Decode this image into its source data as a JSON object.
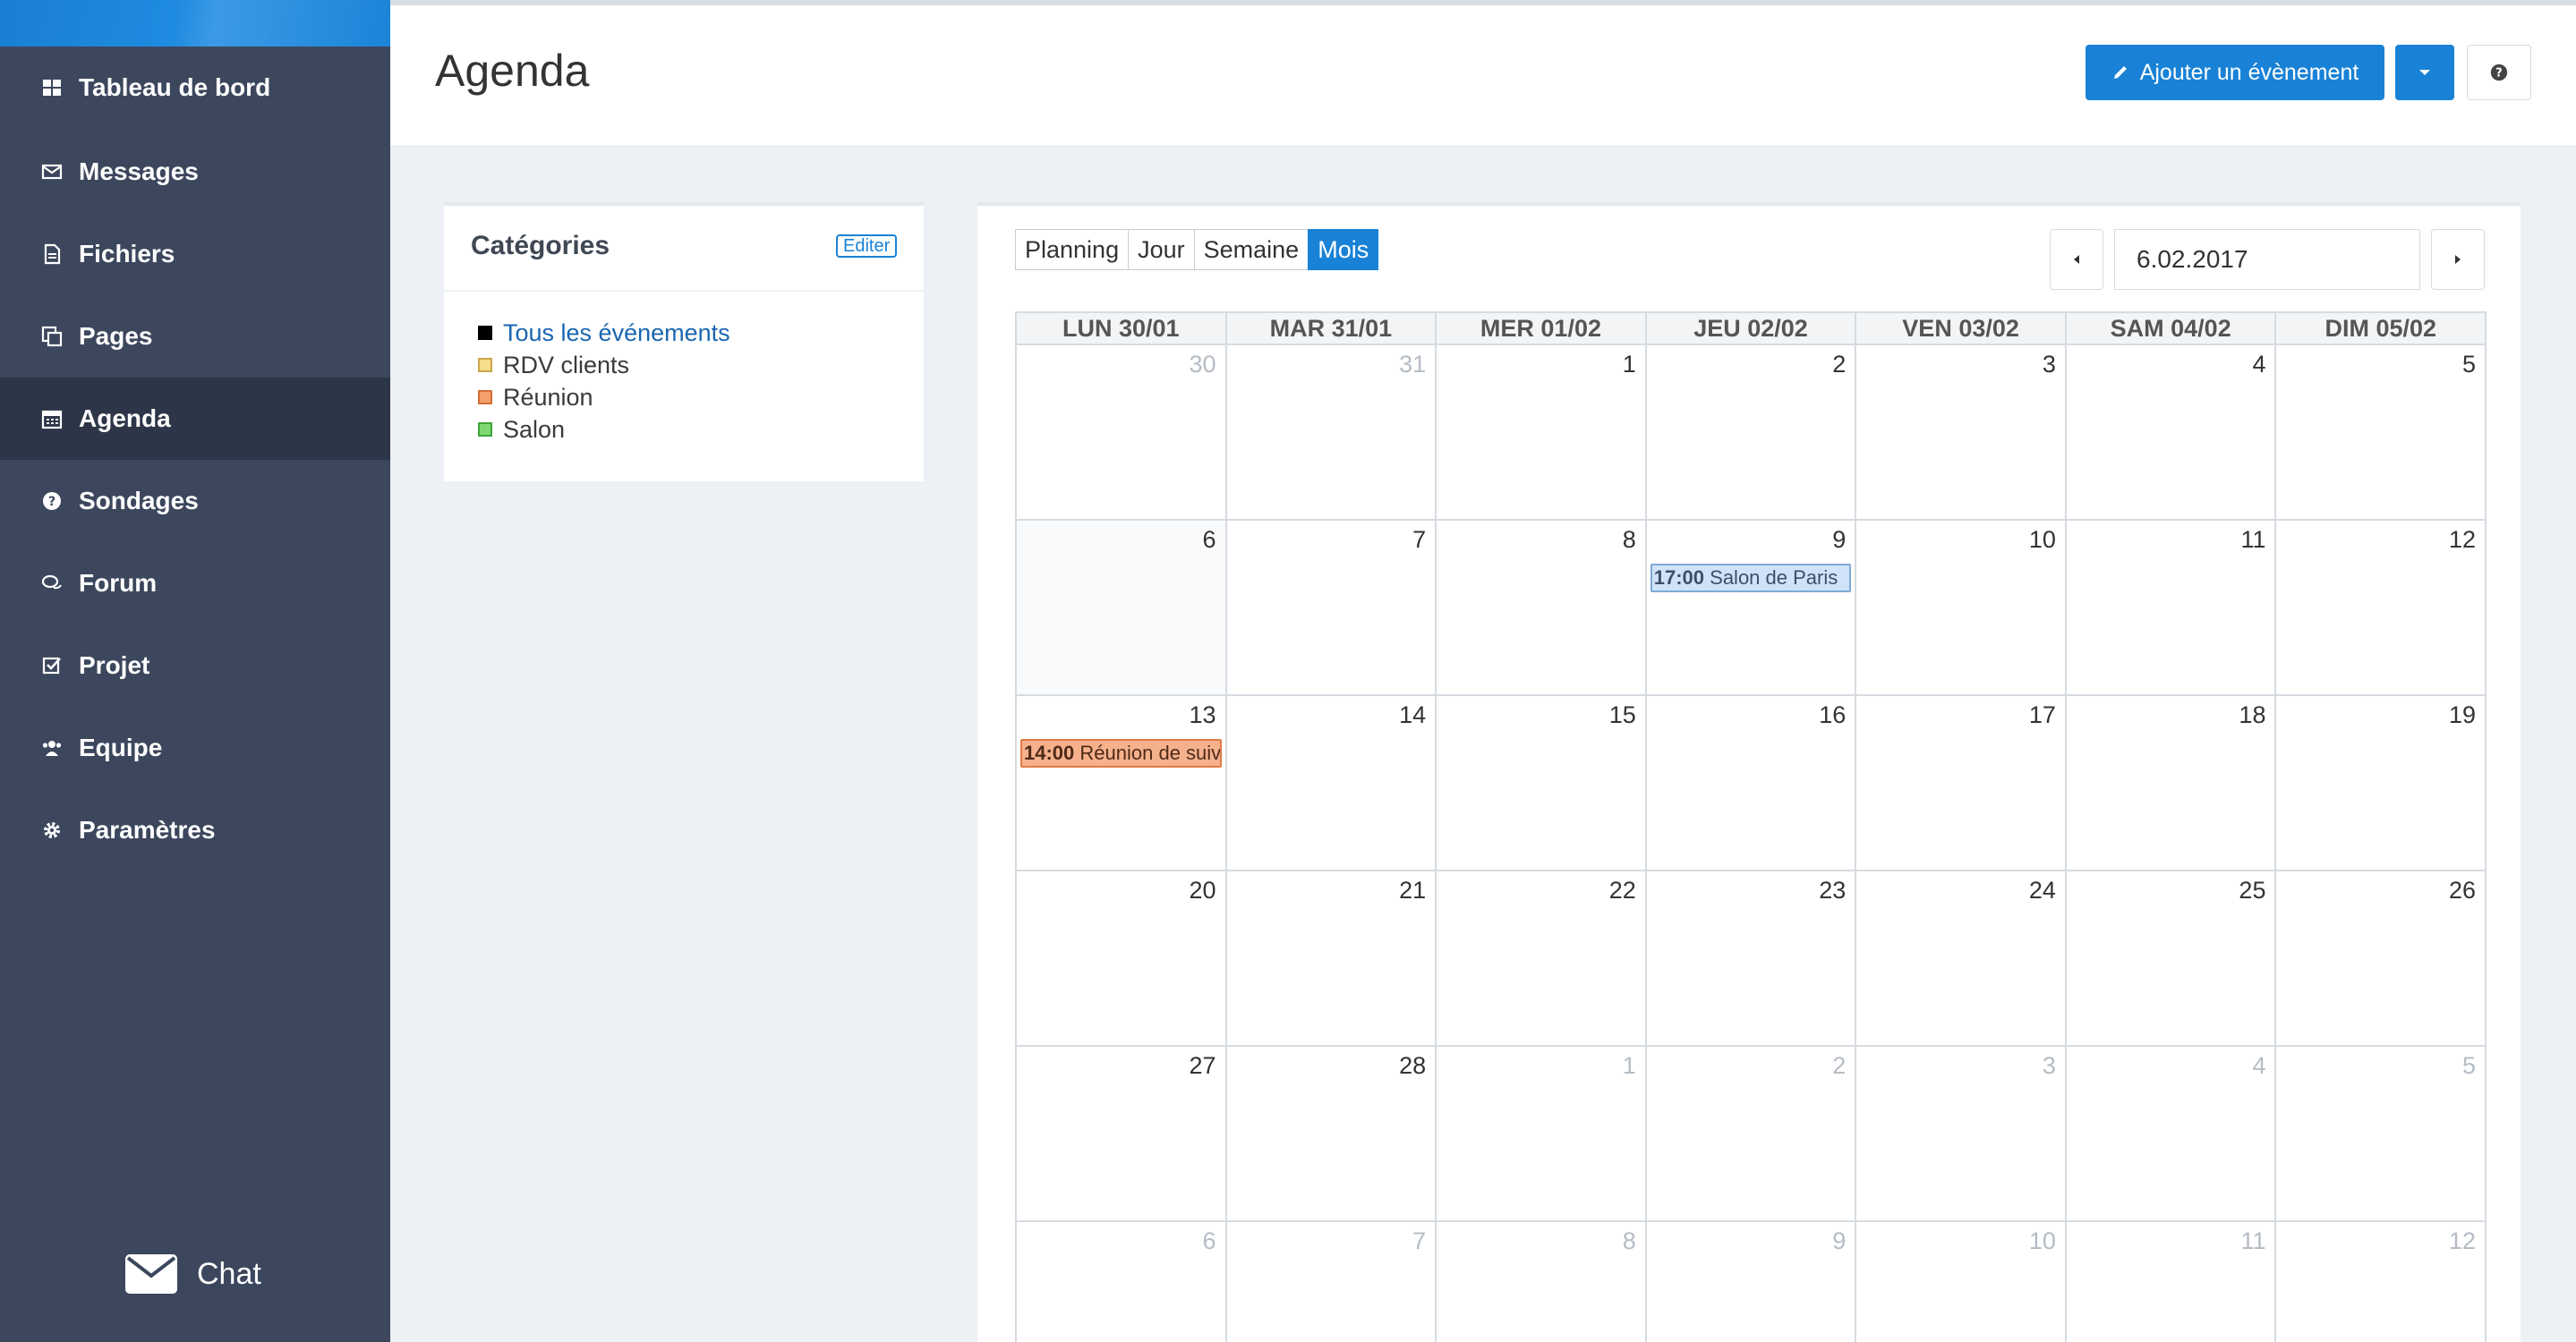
{
  "sidebar": {
    "items": [
      {
        "label": "Tableau de bord",
        "icon": "dashboard-icon"
      },
      {
        "label": "Messages",
        "icon": "envelope-icon"
      },
      {
        "label": "Fichiers",
        "icon": "file-icon"
      },
      {
        "label": "Pages",
        "icon": "pages-icon"
      },
      {
        "label": "Agenda",
        "icon": "calendar-icon",
        "active": true
      },
      {
        "label": "Sondages",
        "icon": "question-icon"
      },
      {
        "label": "Forum",
        "icon": "comments-icon"
      },
      {
        "label": "Projet",
        "icon": "checkbox-icon"
      },
      {
        "label": "Equipe",
        "icon": "users-icon"
      },
      {
        "label": "Paramètres",
        "icon": "gear-icon"
      }
    ],
    "chat_label": "Chat"
  },
  "header": {
    "title": "Agenda",
    "add_label": "Ajouter un évènement"
  },
  "categories": {
    "title": "Catégories",
    "edit_label": "Editer",
    "items": [
      {
        "label": "Tous les événements",
        "color": "#000000"
      },
      {
        "label": "RDV clients",
        "color": "#f7dc8c"
      },
      {
        "label": "Réunion",
        "color": "#f5a06c"
      },
      {
        "label": "Salon",
        "color": "#7fd86f"
      }
    ]
  },
  "calendar": {
    "views": [
      "Planning",
      "Jour",
      "Semaine",
      "Mois"
    ],
    "active_view": "Mois",
    "date": "6.02.2017",
    "weekdays": [
      "LUN 30/01",
      "MAR 31/01",
      "MER 01/02",
      "JEU 02/02",
      "VEN 03/02",
      "SAM 04/02",
      "DIM 05/02"
    ],
    "weeks": [
      [
        "30",
        "31",
        "1",
        "2",
        "3",
        "4",
        "5"
      ],
      [
        "6",
        "7",
        "8",
        "9",
        "10",
        "11",
        "12"
      ],
      [
        "13",
        "14",
        "15",
        "16",
        "17",
        "18",
        "19"
      ],
      [
        "20",
        "21",
        "22",
        "23",
        "24",
        "25",
        "26"
      ],
      [
        "27",
        "28",
        "1",
        "2",
        "3",
        "4",
        "5"
      ],
      [
        "6",
        "7",
        "8",
        "9",
        "10",
        "11",
        "12"
      ]
    ],
    "events": [
      {
        "time": "17:00",
        "title": "Salon de Paris",
        "category": "salon"
      },
      {
        "time": "14:00",
        "title": "Réunion de suivi",
        "category": "reunion"
      }
    ]
  }
}
